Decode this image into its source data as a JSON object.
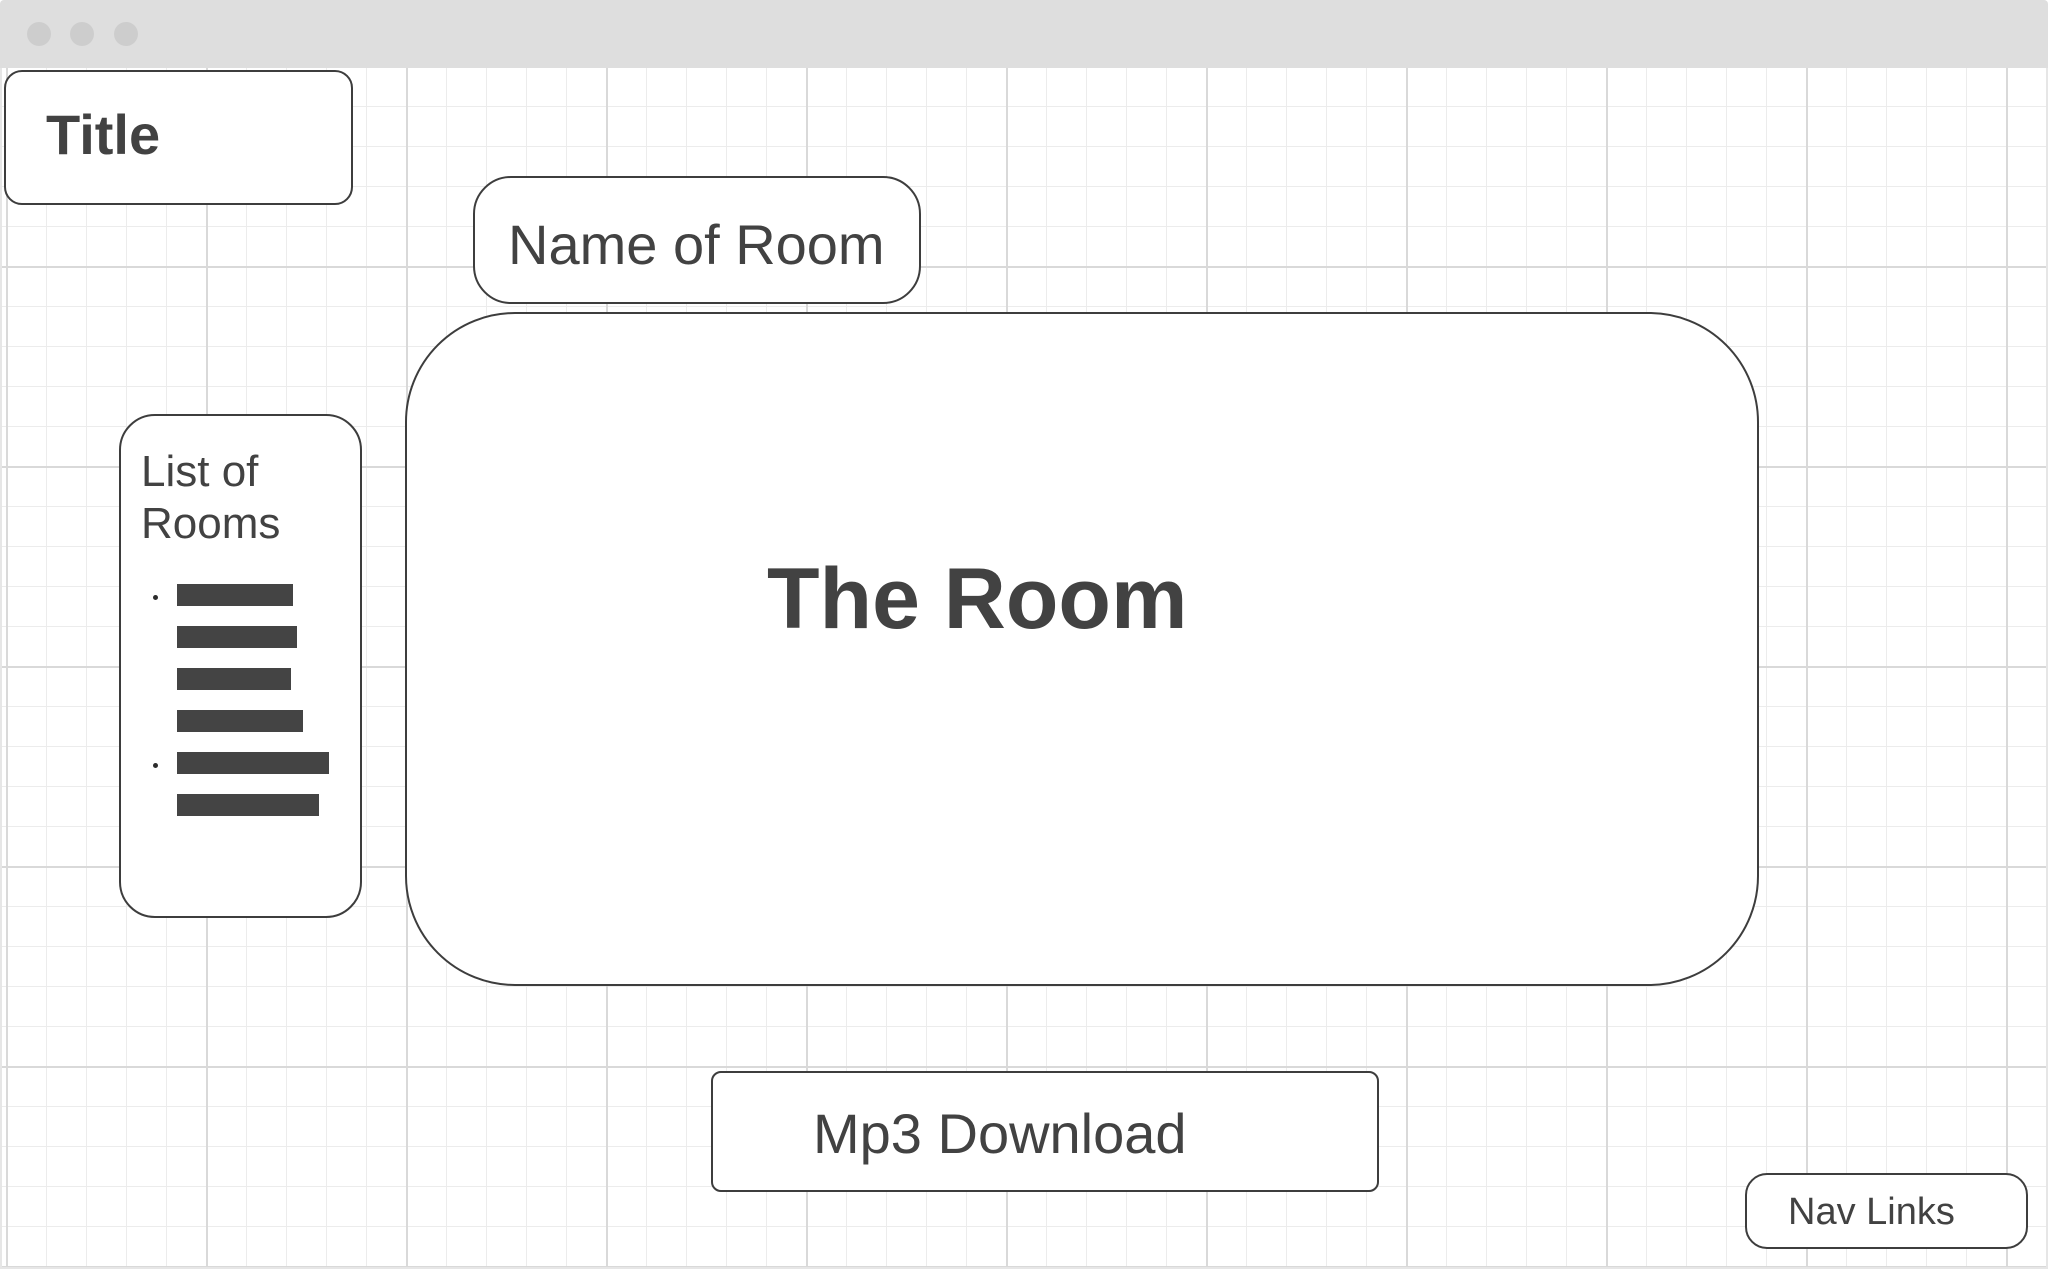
{
  "header": {
    "title": "Title"
  },
  "room": {
    "name_label": "Name of Room",
    "content_label": "The Room"
  },
  "sidebar": {
    "heading": "List of Rooms",
    "bullet_groups": 2,
    "placeholder_lines": 6
  },
  "actions": {
    "download_label": "Mp3 Download"
  },
  "footer": {
    "nav_label": "Nav Links"
  },
  "colors": {
    "titlebar": "#dedede",
    "border": "#3d3d3d",
    "text": "#424242",
    "placeholder_bar": "#444444",
    "grid": "#ececec"
  }
}
